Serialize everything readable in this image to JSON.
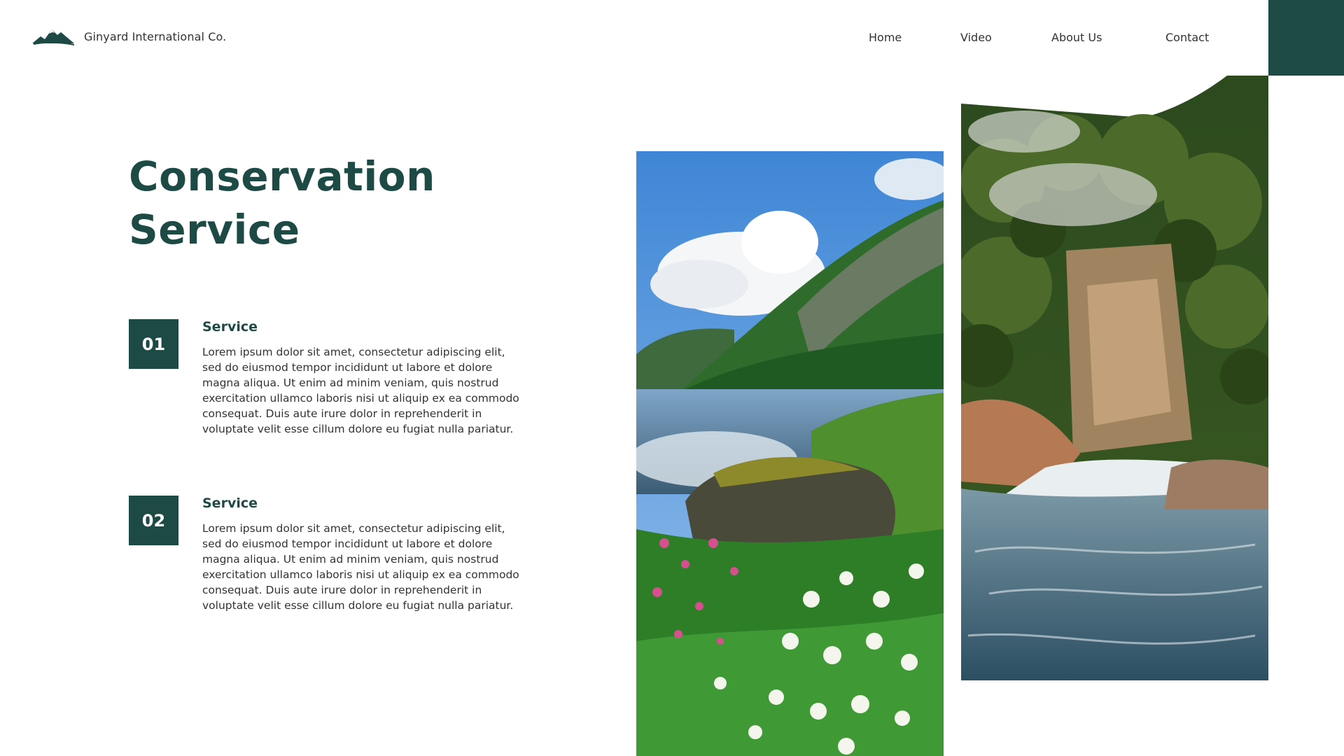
{
  "brand": {
    "name": "Ginyard International Co.",
    "logo_icon": "mountain-icon"
  },
  "nav": {
    "items": [
      {
        "label": "Home"
      },
      {
        "label": "Video"
      },
      {
        "label": "About Us"
      },
      {
        "label": "Contact"
      }
    ]
  },
  "hero": {
    "title": "Conservation Service"
  },
  "services": [
    {
      "number": "01",
      "heading": "Service",
      "text": "Lorem ipsum dolor sit amet, consectetur adipiscing elit, sed do eiusmod tempor incididunt ut labore et dolore magna aliqua. Ut enim ad minim veniam, quis nostrud exercitation ullamco laboris nisi ut aliquip ex ea commodo consequat. Duis aute irure dolor in reprehenderit in voluptate velit esse cillum dolore eu fugiat nulla pariatur."
    },
    {
      "number": "02",
      "heading": "Service",
      "text": "Lorem ipsum dolor sit amet, consectetur adipiscing elit, sed do eiusmod tempor incididunt ut labore et dolore magna aliqua. Ut enim ad minim veniam, quis nostrud exercitation ullamco laboris nisi ut aliquip ex ea commodo consequat. Duis aute irure dolor in reprehenderit in voluptate velit esse cillum dolore eu fugiat nulla pariatur."
    }
  ],
  "colors": {
    "brand_green": "#1e4a46",
    "text": "#333333",
    "background": "#ffffff"
  }
}
